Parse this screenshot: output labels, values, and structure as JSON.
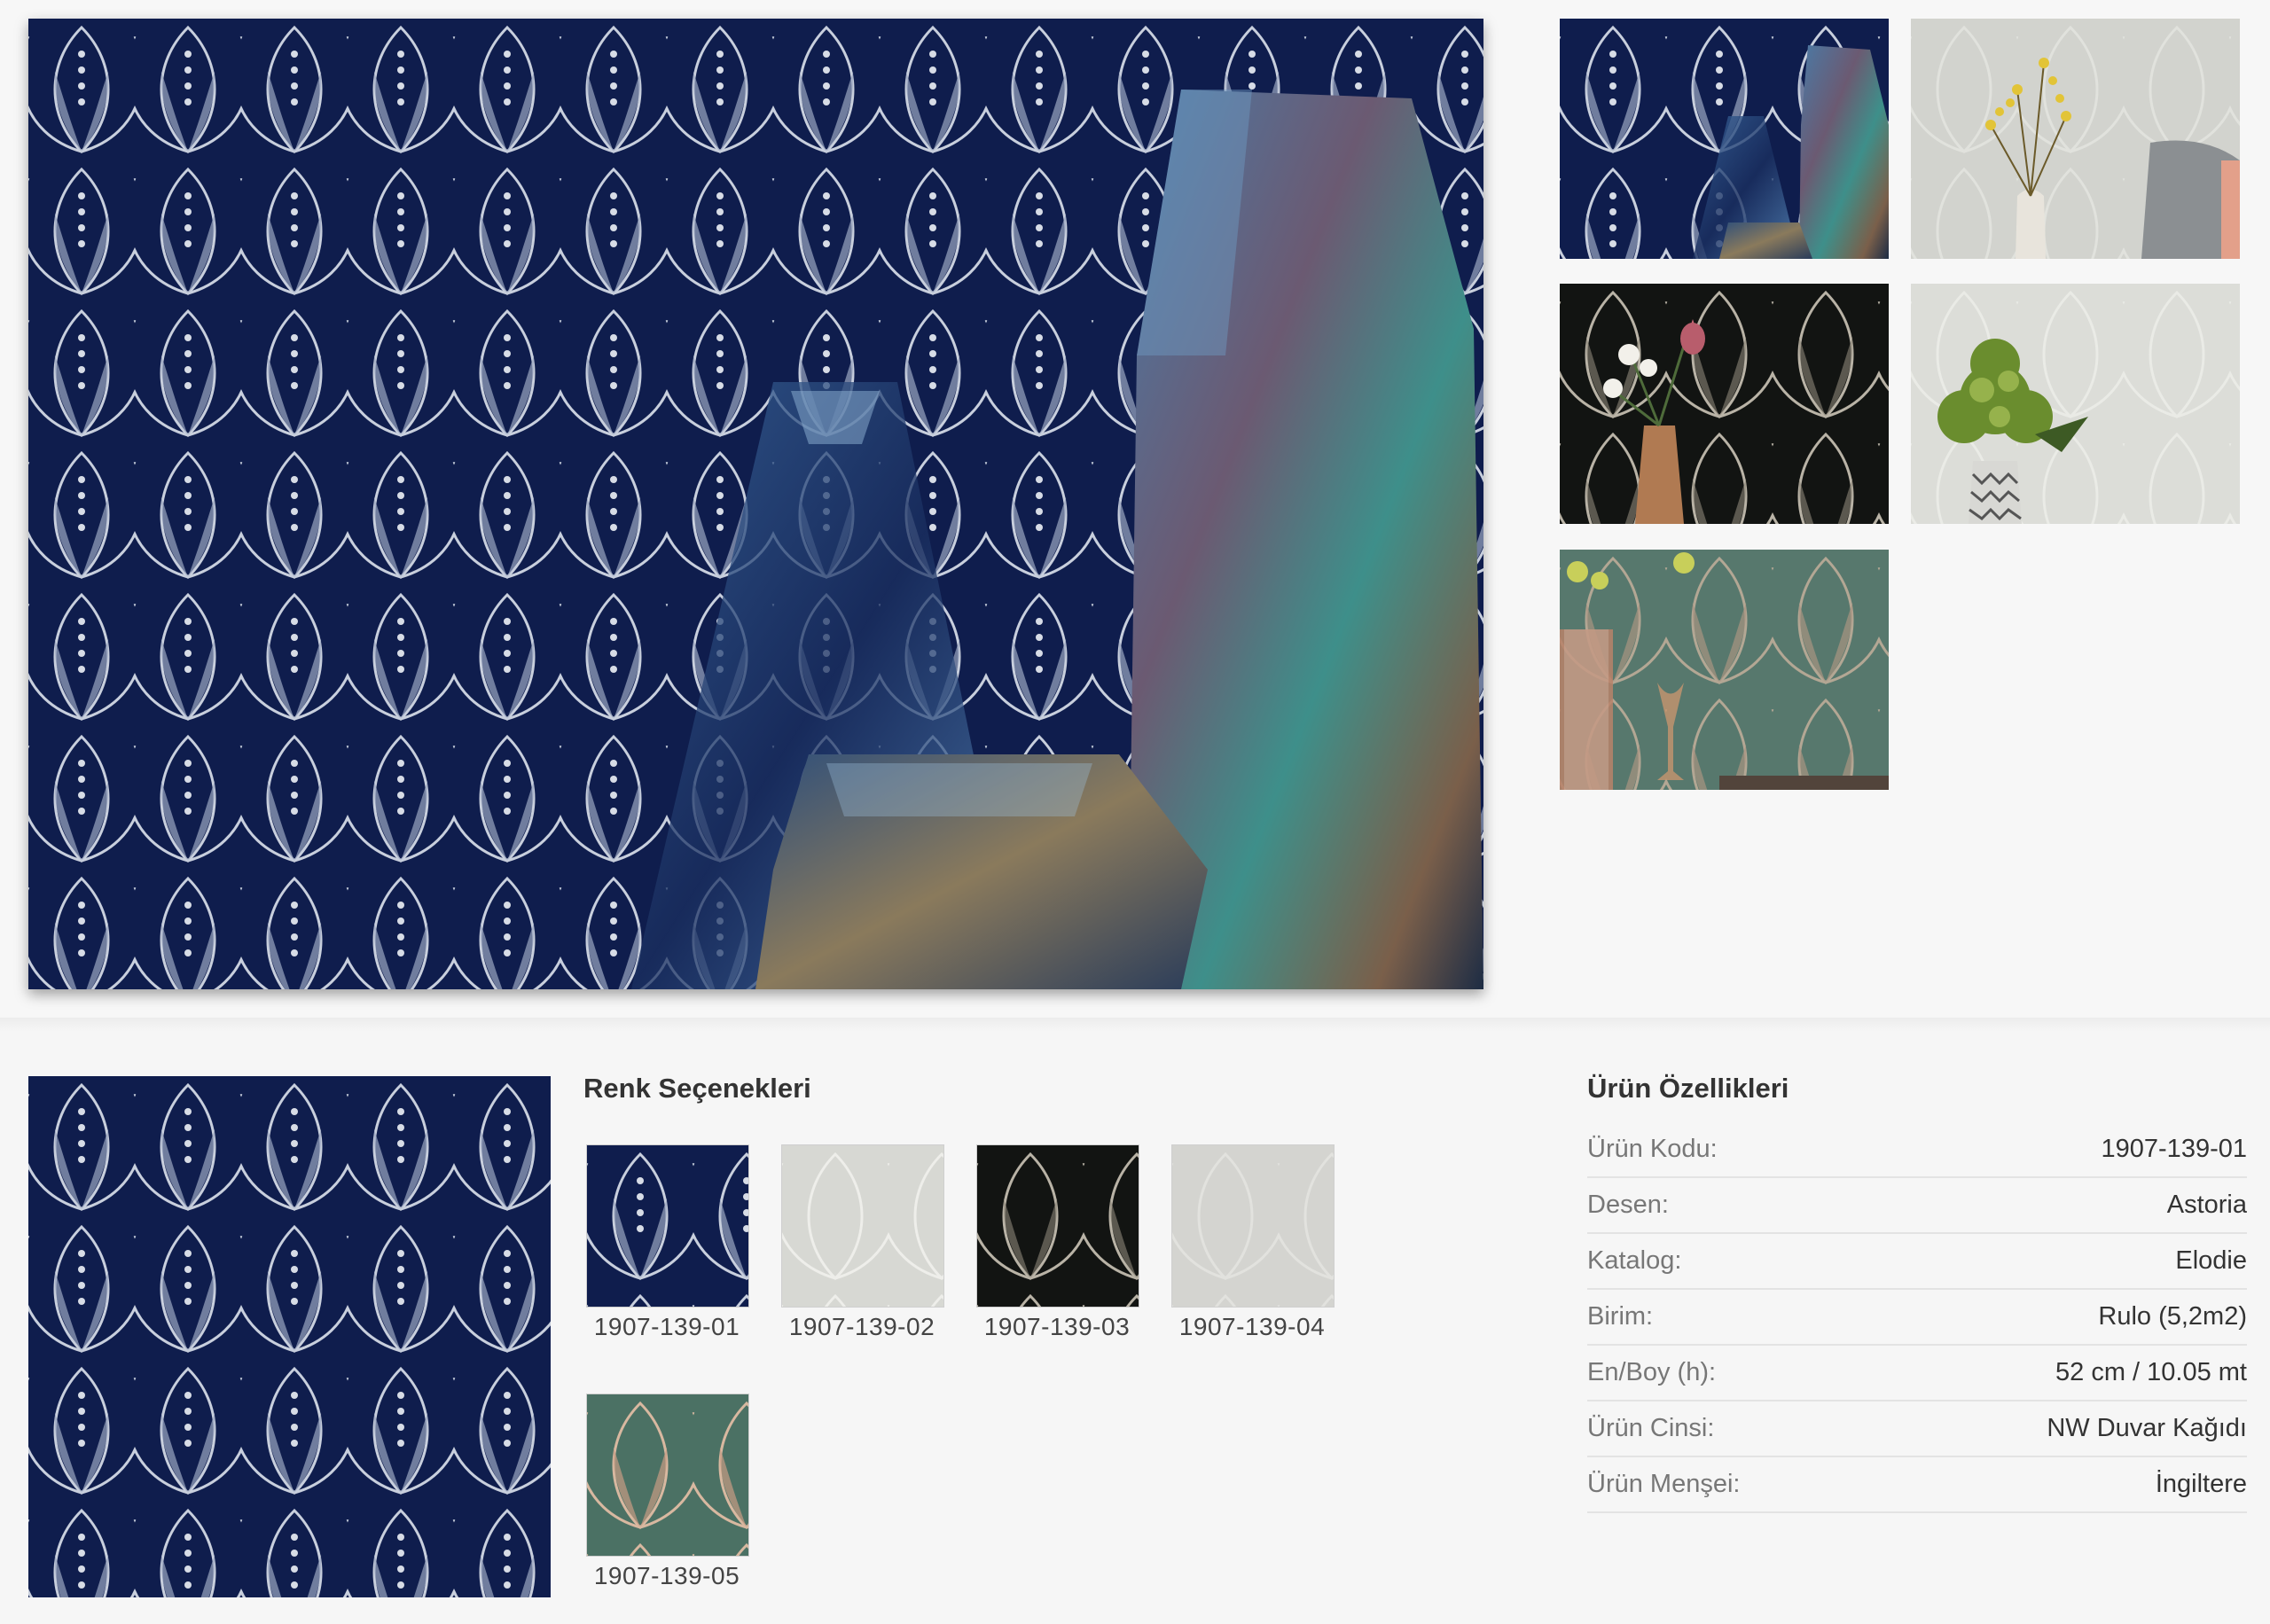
{
  "gallery": {
    "main_image_alt": "Astoria 1907-139-01",
    "thumbnails": [
      {
        "name": "thumb-navy-vases"
      },
      {
        "name": "thumb-grey-chair"
      },
      {
        "name": "thumb-black-flowers"
      },
      {
        "name": "thumb-white-hydrangea"
      },
      {
        "name": "thumb-green-glass"
      }
    ]
  },
  "color_options": {
    "heading": "Renk Seçenekleri",
    "items": [
      {
        "code": "1907-139-01",
        "color": "#152a63"
      },
      {
        "code": "1907-139-02",
        "color": "#d9dad4"
      },
      {
        "code": "1907-139-03",
        "color": "#151816"
      },
      {
        "code": "1907-139-04",
        "color": "#d3d3cf"
      },
      {
        "code": "1907-139-05",
        "color": "#4f7a6c"
      }
    ]
  },
  "features": {
    "heading": "Ürün Özellikleri",
    "rows": [
      {
        "label": "Ürün Kodu:",
        "value": "1907-139-01"
      },
      {
        "label": "Desen:",
        "value": "Astoria"
      },
      {
        "label": "Katalog:",
        "value": "Elodie"
      },
      {
        "label": "Birim:",
        "value": "Rulo (5,2m2)"
      },
      {
        "label": "En/Boy (h):",
        "value": "52 cm / 10.05 mt"
      },
      {
        "label": "Ürün Cinsi:",
        "value": "NW Duvar Kağıdı"
      },
      {
        "label": "Ürün Menşei:",
        "value": "İngiltere"
      }
    ]
  },
  "colors": {
    "navy": "#0f1a44",
    "page_bg": "#f6f6f6",
    "text": "#333333",
    "muted": "#777777",
    "divider": "#e3e3e3"
  }
}
